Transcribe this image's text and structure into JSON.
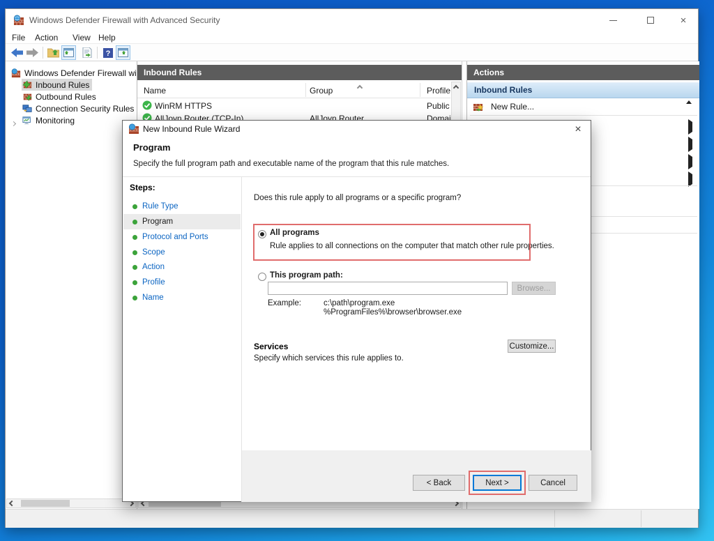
{
  "window": {
    "title": "Windows Defender Firewall with Advanced Security",
    "menu": {
      "file": "File",
      "action": "Action",
      "view": "View",
      "help": "Help"
    }
  },
  "tree": {
    "root": "Windows Defender Firewall with Advanced Security",
    "items": [
      {
        "label": "Inbound Rules",
        "selected": true
      },
      {
        "label": "Outbound Rules",
        "selected": false
      },
      {
        "label": "Connection Security Rules",
        "selected": false
      },
      {
        "label": "Monitoring",
        "selected": false,
        "expander": true
      }
    ]
  },
  "rules_panel": {
    "title": "Inbound Rules",
    "columns": {
      "name": "Name",
      "group": "Group",
      "profile": "Profile"
    },
    "rows": [
      {
        "name": "WinRM HTTPS",
        "group": "",
        "profile": "Public"
      },
      {
        "name": "AllJoyn Router (TCP-In)",
        "group": "AllJoyn Router",
        "profile": "Domai..."
      }
    ]
  },
  "actions_panel": {
    "title": "Actions",
    "section": "Inbound Rules",
    "new_rule": "New Rule..."
  },
  "wizard": {
    "title": "New Inbound Rule Wizard",
    "close_glyph": "×",
    "heading": "Program",
    "subheading": "Specify the full program path and executable name of the program that this rule matches.",
    "steps_label": "Steps:",
    "steps": [
      {
        "label": "Rule Type",
        "current": false
      },
      {
        "label": "Program",
        "current": true
      },
      {
        "label": "Protocol and Ports",
        "current": false
      },
      {
        "label": "Scope",
        "current": false
      },
      {
        "label": "Action",
        "current": false
      },
      {
        "label": "Profile",
        "current": false
      },
      {
        "label": "Name",
        "current": false
      }
    ],
    "question": "Does this rule apply to all programs or a specific program?",
    "all_programs": {
      "label": "All programs",
      "description": "Rule applies to all connections on the computer that match other rule properties.",
      "selected": true
    },
    "program_path": {
      "label": "This program path:",
      "value": "",
      "browse_label": "Browse...",
      "selected": false
    },
    "example_label": "Example:",
    "example_line1": "c:\\path\\program.exe",
    "example_line2": "%ProgramFiles%\\browser\\browser.exe",
    "services": {
      "heading": "Services",
      "description": "Specify which services this rule applies to.",
      "customize_label": "Customize..."
    },
    "buttons": {
      "back": "< Back",
      "next": "Next >",
      "cancel": "Cancel"
    }
  },
  "colors": {
    "annotation_red": "#e06c6c",
    "focus_blue": "#0078d7",
    "panel_header_gray": "#5c5c5c",
    "desktop_blue": "#0d63cd",
    "step_bullet_green": "#3ba33a",
    "rule_check_green": "#3cb54a"
  }
}
